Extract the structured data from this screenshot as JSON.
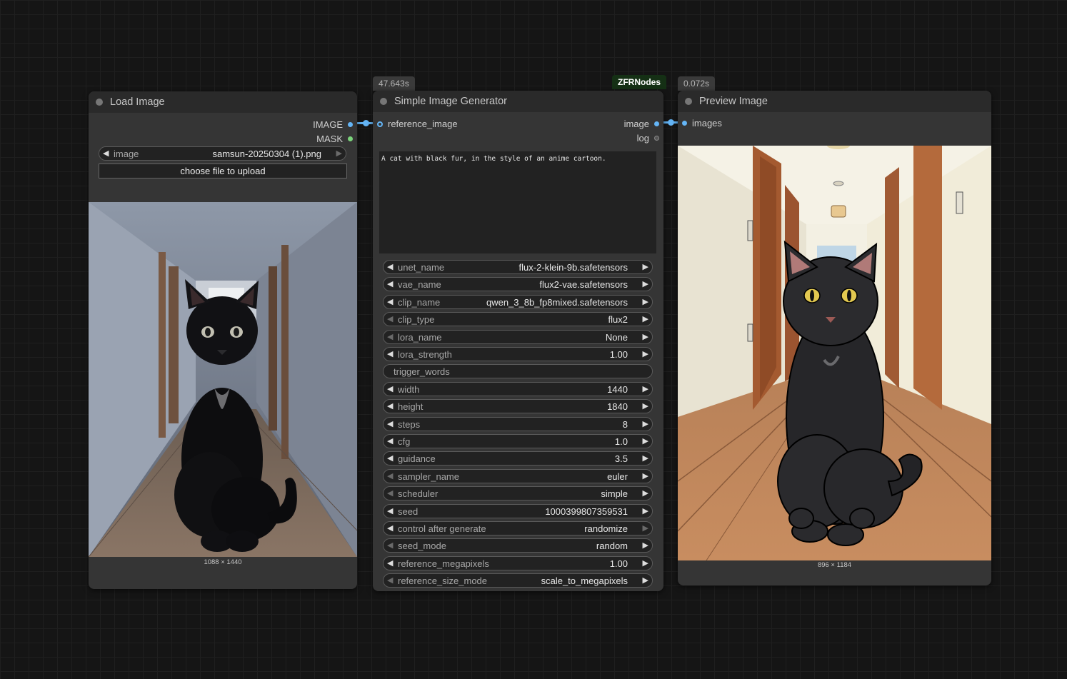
{
  "load_image_node": {
    "title": "Load Image",
    "outputs": [
      "IMAGE",
      "MASK"
    ],
    "image_widget": {
      "label": "image",
      "value": "samsun-20250304 (1).png"
    },
    "upload_button": "choose file to upload",
    "image_caption": "1088 × 1440"
  },
  "generator_node": {
    "title": "Simple Image Generator",
    "time_badge": "47.643s",
    "source_badge": "ZFRNodes",
    "input": "reference_image",
    "outputs": [
      "image",
      "log"
    ],
    "prompt": "A cat with black fur, in the style of an anime cartoon.",
    "widgets": [
      {
        "label": "unet_name",
        "value": "flux-2-klein-9b.safetensors"
      },
      {
        "label": "vae_name",
        "value": "flux2-vae.safetensors"
      },
      {
        "label": "clip_name",
        "value": "qwen_3_8b_fp8mixed.safetensors"
      },
      {
        "label": "clip_type",
        "value": "flux2"
      },
      {
        "label": "lora_name",
        "value": "None"
      },
      {
        "label": "lora_strength",
        "value": "1.00"
      },
      {
        "label": "trigger_words",
        "value": ""
      },
      {
        "label": "width",
        "value": "1440"
      },
      {
        "label": "height",
        "value": "1840"
      },
      {
        "label": "steps",
        "value": "8"
      },
      {
        "label": "cfg",
        "value": "1.0"
      },
      {
        "label": "guidance",
        "value": "3.5"
      },
      {
        "label": "sampler_name",
        "value": "euler"
      },
      {
        "label": "scheduler",
        "value": "simple"
      },
      {
        "label": "seed",
        "value": "1000399807359531"
      },
      {
        "label": "control after generate",
        "value": "randomize"
      },
      {
        "label": "seed_mode",
        "value": "random"
      },
      {
        "label": "reference_megapixels",
        "value": "1.00"
      },
      {
        "label": "reference_size_mode",
        "value": "scale_to_megapixels"
      }
    ]
  },
  "preview_node": {
    "title": "Preview Image",
    "time_badge": "0.072s",
    "input": "images",
    "image_caption": "896 × 1184"
  },
  "colors": {
    "link": "#64b5f6",
    "mask_slot": "#7bd47b",
    "node_bg": "#353535",
    "canvas_bg": "#151515"
  }
}
